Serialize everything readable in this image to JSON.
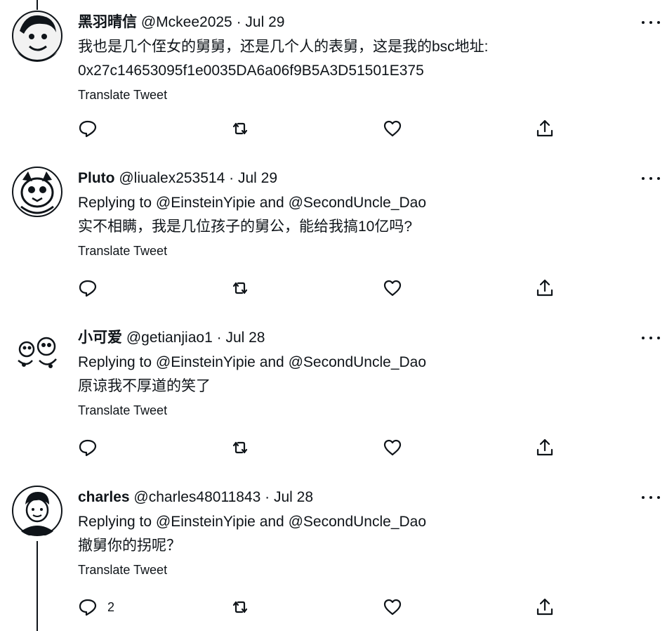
{
  "tweets": [
    {
      "display_name": "黑羽晴信",
      "handle": "@Mckee2025",
      "date": "Jul 29",
      "lines": [
        "我也是几个侄女的舅舅，还是几个人的表舅，这是我的bsc地址:",
        "0x27c14653095f1e0035DA6a06f9B5A3D51501E375"
      ],
      "translate": "Translate Tweet",
      "reply_count": ""
    },
    {
      "display_name": "Pluto",
      "handle": "@liualex253514",
      "date": "Jul 29",
      "replying_prefix": "Replying to",
      "replying_to_1": "@EinsteinYipie",
      "replying_and": "and",
      "replying_to_2": "@SecondUncle_Dao",
      "lines": [
        "实不相瞒，我是几位孩子的舅公，能给我搞10亿吗?"
      ],
      "translate": "Translate Tweet",
      "reply_count": ""
    },
    {
      "display_name": "小可爱",
      "handle": "@getianjiao1",
      "date": "Jul 28",
      "replying_prefix": "Replying to",
      "replying_to_1": "@EinsteinYipie",
      "replying_and": "and",
      "replying_to_2": "@SecondUncle_Dao",
      "lines": [
        "原谅我不厚道的笑了"
      ],
      "translate": "Translate Tweet",
      "reply_count": ""
    },
    {
      "display_name": "charles",
      "handle": "@charles48011843",
      "date": "Jul 28",
      "replying_prefix": "Replying to",
      "replying_to_1": "@EinsteinYipie",
      "replying_and": "and",
      "replying_to_2": "@SecondUncle_Dao",
      "lines": [
        "撤舅你的拐呢？"
      ],
      "translate": "Translate Tweet",
      "reply_count": "2"
    }
  ],
  "ui": {
    "separator": "·",
    "text_color": "#0f1419",
    "icons": [
      "reply-icon",
      "retweet-icon",
      "like-icon",
      "share-icon",
      "more-icon"
    ]
  }
}
